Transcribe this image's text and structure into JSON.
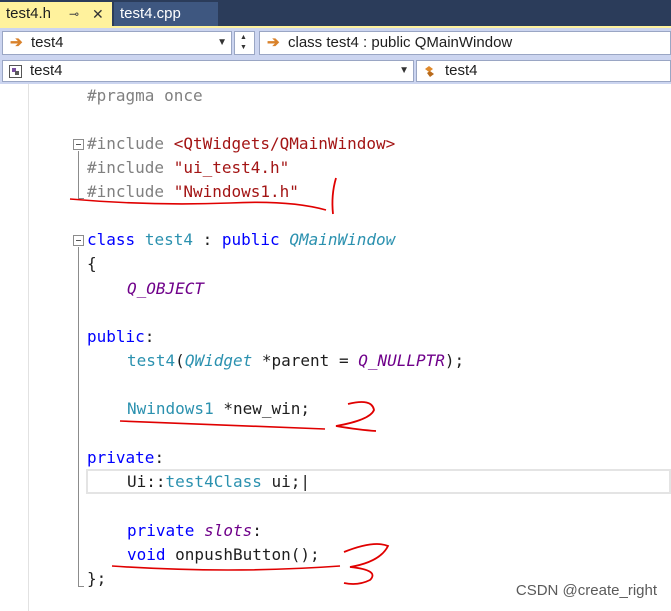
{
  "tabs": [
    {
      "label": "test4.h",
      "active": true
    },
    {
      "label": "test4.cpp",
      "active": false
    }
  ],
  "navbar": {
    "class_combo": "test4",
    "scope_combo": "class test4 : public QMainWindow",
    "type_combo": "test4",
    "member_combo": "test4"
  },
  "code": {
    "pragma": "#pragma once",
    "inc_kw1": "#include",
    "inc_path1": "<QtWidgets/QMainWindow>",
    "inc_kw2": "#include",
    "inc_path2": "\"ui_test4.h\"",
    "inc_kw3": "#include",
    "inc_path3": "\"Nwindows1.h\"",
    "class_kw": "class",
    "class_name": "test4",
    "colon": " : ",
    "public_kw": "public",
    "base_class": "QMainWindow",
    "open_brace": "{",
    "q_object": "Q_OBJECT",
    "public_label": "public",
    "colon_char": ":",
    "ctor_name": "test4",
    "paren_open": "(",
    "param_type": "QWidget",
    "param_rest": " *parent = ",
    "null_ptr": "Q_NULLPTR",
    "ctor_end": ");",
    "member_type": "Nwindows1",
    "member_rest": " *new_win;",
    "private_label": "private",
    "ui_ns": "Ui::",
    "ui_class": "test4Class",
    "ui_rest": " ui;",
    "private_kw": "private",
    "slots_kw": "slots",
    "slots_colon": ":",
    "void_kw": "void",
    "method_rest": " onpushButton();",
    "close_brace": "};"
  },
  "watermark": "CSDN @create_right",
  "colors": {
    "keyword": "#0000ff",
    "type": "#2b91af",
    "macro": "#6f008a",
    "string": "#a31515",
    "annotation": "#e00000"
  }
}
